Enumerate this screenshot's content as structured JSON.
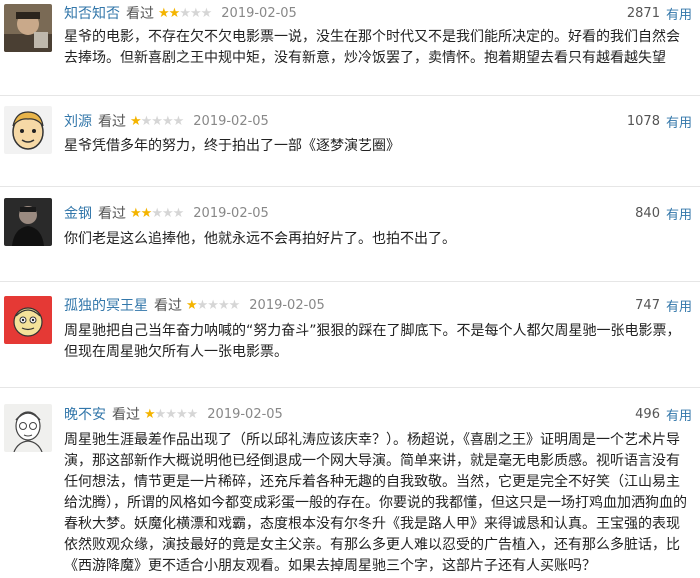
{
  "reviews": [
    {
      "user": "知否知否",
      "action": "看过",
      "stars": 2,
      "date": "2019-02-05",
      "votes": "2871",
      "useful": "有用",
      "content": "星爷的电影，不存在欠不欠电影票一说，没生在那个时代又不是我们能所决定的。好看的我们自然会去捧场。但新喜剧之王中规中矩，没有新意，炒冷饭罢了，卖情怀。抱着期望去看只有越看越失望"
    },
    {
      "user": "刘源",
      "action": "看过",
      "stars": 1,
      "date": "2019-02-05",
      "votes": "1078",
      "useful": "有用",
      "content": "星爷凭借多年的努力，终于拍出了一部《逐梦演艺圈》"
    },
    {
      "user": "金钢",
      "action": "看过",
      "stars": 2,
      "date": "2019-02-05",
      "votes": "840",
      "useful": "有用",
      "content": "你们老是这么追捧他，他就永远不会再拍好片了。也拍不出了。"
    },
    {
      "user": "孤独的冥王星",
      "action": "看过",
      "stars": 1,
      "date": "2019-02-05",
      "votes": "747",
      "useful": "有用",
      "content": "周星驰把自己当年奋力呐喊的“努力奋斗”狠狠的踩在了脚底下。不是每个人都欠周星驰一张电影票，但现在周星驰欠所有人一张电影票。"
    },
    {
      "user": "晚不安",
      "action": "看过",
      "stars": 1,
      "date": "2019-02-05",
      "votes": "496",
      "useful": "有用",
      "content": "周星驰生涯最差作品出现了（所以邱礼涛应该庆幸？）。杨超说，《喜剧之王》证明周是一个艺术片导演，那这部新作大概说明他已经倒退成一个网大导演。简单来讲，就是毫无电影质感。视听语言没有任何想法，情节更是一片稀碎，还充斥着各种无趣的自我致敬。当然，它更是完全不好笑（江山易主给沈腾），所谓的风格如今都变成彩蛋一般的存在。你要说的我都懂，但这只是一场打鸡血加洒狗血的春秋大梦。妖魔化横漂和戏霸，态度根本没有尔冬升《我是路人甲》来得诚恳和认真。王宝强的表现依然败观众缘，演技最好的竟是女主父亲。有那么多更人难以忍受的广告植入，还有那么多脏话，比《西游降魔》更不适合小朋友观看。如果去掉周星驰三个字，这部片子还有人买账吗？"
    }
  ]
}
